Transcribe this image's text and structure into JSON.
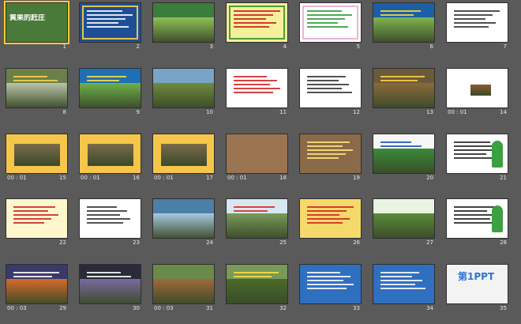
{
  "slides": [
    {
      "num": "1",
      "bg": "#4a7a3a",
      "style": "title",
      "text": "黄果的赶庄",
      "fg": "#ffffff"
    },
    {
      "num": "2",
      "bg": "#1e4f96",
      "style": "wordlist",
      "frame": "#e8c34a",
      "fg": "#ffffff"
    },
    {
      "num": "3",
      "bg": "#3b7d3a",
      "style": "photo",
      "accent": "#8fbf55"
    },
    {
      "num": "4",
      "bg": "#f6f09a",
      "style": "text-red",
      "frame": "#4d9e38",
      "fg": "#cc1b1b"
    },
    {
      "num": "5",
      "bg": "#ffffff",
      "style": "text-green",
      "frame": "#e7b6d8",
      "fg": "#2f9a3a"
    },
    {
      "num": "6",
      "bg": "#1c5fa7",
      "style": "photo-text",
      "accent": "#7fb34e",
      "fg": "#ffdd33"
    },
    {
      "num": "7",
      "bg": "#ffffff",
      "style": "text-plain",
      "fg": "#333333"
    },
    {
      "num": "8",
      "bg": "#6b7f4a",
      "style": "photo-dark",
      "accent": "#b9c4a8",
      "fg": "#ffd24a"
    },
    {
      "num": "9",
      "bg": "#1f6fb4",
      "style": "photo-box",
      "accent": "#6fb04b",
      "fg": "#ffe23d"
    },
    {
      "num": "10",
      "bg": "#77a5c8",
      "style": "photo",
      "accent": "#6e8b3d"
    },
    {
      "num": "11",
      "bg": "#ffffff",
      "style": "text-red",
      "frame": "#ffffff",
      "fg": "#cc2222"
    },
    {
      "num": "12",
      "bg": "#ffffff",
      "style": "text-plain",
      "fg": "#333333"
    },
    {
      "num": "13",
      "bg": "#6b5a3a",
      "style": "photo-dark",
      "accent": "#8a6a3a",
      "fg": "#ffd24a"
    },
    {
      "num": "14",
      "bg": "#ffffff",
      "style": "photo-small",
      "accent": "#8a5a30",
      "time": "00 : 01"
    },
    {
      "num": "15",
      "bg": "#f5c64a",
      "style": "frame-photo",
      "accent": "#7a6a4a",
      "time": "00 : 01"
    },
    {
      "num": "16",
      "bg": "#f5c64a",
      "style": "frame-photo",
      "accent": "#7a6a4a",
      "time": "00 : 01"
    },
    {
      "num": "17",
      "bg": "#f5c64a",
      "style": "frame-photo",
      "accent": "#7a6a4a",
      "time": "00 : 01"
    },
    {
      "num": "18",
      "bg": "#9a7450",
      "style": "plain",
      "time": "00 : 01"
    },
    {
      "num": "19",
      "bg": "#8a6a48",
      "style": "text-over",
      "fg": "#ffe880"
    },
    {
      "num": "20",
      "bg": "#f7f7f7",
      "style": "photo-text",
      "accent": "#3a8b3a",
      "fg": "#2050c0"
    },
    {
      "num": "21",
      "bg": "#ffffff",
      "style": "tree-list",
      "accent": "#3aa040",
      "fg": "#222222"
    },
    {
      "num": "22",
      "bg": "#fff7cc",
      "style": "text-red",
      "frame": "#fff7cc",
      "fg": "#cc2222"
    },
    {
      "num": "23",
      "bg": "#ffffff",
      "style": "text-plain",
      "fg": "#333333"
    },
    {
      "num": "24",
      "bg": "#4b7fa8",
      "style": "photo",
      "accent": "#a8c8e0"
    },
    {
      "num": "25",
      "bg": "#d8e8f0",
      "style": "photo-text",
      "accent": "#7a9a5a",
      "fg": "#dd2222"
    },
    {
      "num": "26",
      "bg": "#f5d96a",
      "style": "text-red",
      "frame": "#f5d96a",
      "fg": "#cc2222"
    },
    {
      "num": "27",
      "bg": "#e8f4e0",
      "style": "photo",
      "accent": "#5a8a3a"
    },
    {
      "num": "28",
      "bg": "#ffffff",
      "style": "tree-list",
      "accent": "#3aa040",
      "fg": "#222222"
    },
    {
      "num": "29",
      "bg": "#3a3a6a",
      "style": "photo-dark",
      "accent": "#d86a2a",
      "fg": "#ffffff",
      "time": "00 : 03"
    },
    {
      "num": "30",
      "bg": "#2a2a3a",
      "style": "photo-dark",
      "accent": "#7a6aa0",
      "fg": "#ffffff"
    },
    {
      "num": "31",
      "bg": "#6a8a4a",
      "style": "photo",
      "accent": "#a06a3a",
      "time": "00 : 03"
    },
    {
      "num": "32",
      "bg": "#7a9a5a",
      "style": "photo-text",
      "accent": "#4a6a2a",
      "fg": "#ffe040"
    },
    {
      "num": "33",
      "bg": "#2f6fc0",
      "style": "text-plain",
      "fg": "#ffffff"
    },
    {
      "num": "34",
      "bg": "#2f6fc0",
      "style": "text-plain",
      "fg": "#ffffff"
    },
    {
      "num": "35",
      "bg": "#f3f3f3",
      "style": "logo",
      "text": "第1PPT",
      "fg": "#2c74d6"
    }
  ],
  "selected": "1"
}
